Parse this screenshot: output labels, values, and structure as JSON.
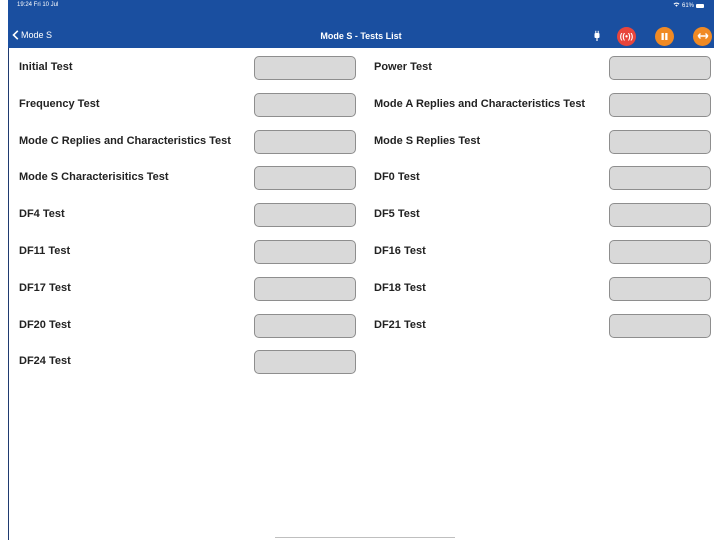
{
  "status": {
    "time": "19:24 Fri 10 Jul",
    "battery": "61%"
  },
  "nav": {
    "back_label": "Mode S",
    "title": "Mode S - Tests List"
  },
  "colors": {
    "bar": "#1a4fa0",
    "red": "#e8453c",
    "orange": "#f08a24",
    "box": "#d9d9d9"
  },
  "icons": [
    "plug-icon",
    "broadcast-icon",
    "pause-icon",
    "swap-icon"
  ],
  "tests_left": [
    "Initial Test",
    "Frequency Test",
    "Mode C Replies and Characteristics Test",
    "Mode S Characterisitics Test",
    "DF4 Test",
    "DF11 Test",
    "DF17 Test",
    "DF20 Test",
    "DF24 Test"
  ],
  "tests_right": [
    "Power Test",
    "Mode A Replies and Characteristics Test",
    "Mode S Replies Test",
    "DF0 Test",
    "DF5 Test",
    "DF16 Test",
    "DF18 Test",
    "DF21 Test"
  ]
}
